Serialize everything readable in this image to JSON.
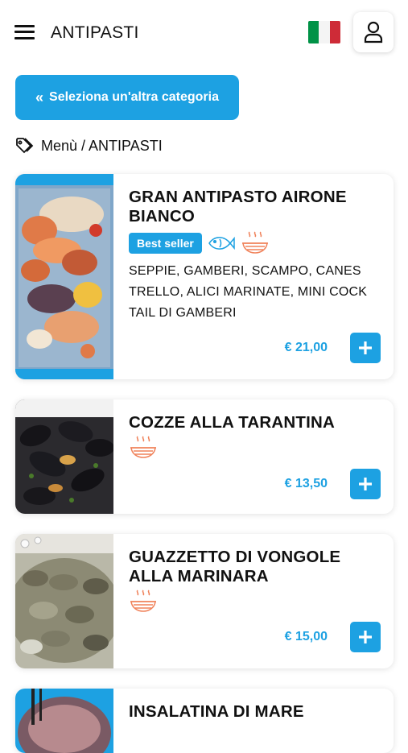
{
  "header": {
    "title": "ANTIPASTI",
    "menu_icon": "hamburger-icon",
    "flag_icon": "italy-flag-icon",
    "user_icon": "user-icon"
  },
  "category_button": {
    "label": "Seleziona un'altra categoria",
    "icon": "double-chevron-left-icon"
  },
  "breadcrumb": {
    "icon": "tag-icon",
    "text": "Menù / ANTIPASTI"
  },
  "colors": {
    "accent": "#1da1e2",
    "allergen_icon": "#f0825a",
    "flag_green": "#009246",
    "flag_white": "#ffffff",
    "flag_red": "#ce2b37"
  },
  "dishes": [
    {
      "name": "GRAN ANTIPASTO AIRONE BIANCO",
      "badge": "Best seller",
      "icons": [
        "fish-icon",
        "hot-dish-icon"
      ],
      "description": "SEPPIE, GAMBERI, SCAMPO, CANES TRELLO, ALICI MARINATE, MINI COCK TAIL DI GAMBERI",
      "price": "€ 21,00"
    },
    {
      "name": "COZZE ALLA TARANTINA",
      "icons": [
        "hot-dish-icon"
      ],
      "price": "€ 13,50"
    },
    {
      "name": "GUAZZETTO DI VONGOLE ALLA MARINARA",
      "icons": [
        "hot-dish-icon"
      ],
      "price": "€ 15,00"
    },
    {
      "name": "INSALATINA DI MARE"
    }
  ]
}
